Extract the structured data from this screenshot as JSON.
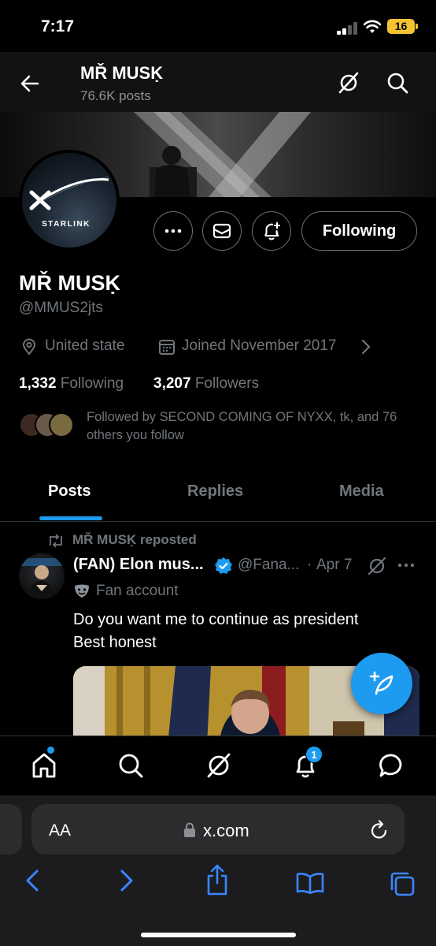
{
  "status_bar": {
    "time": "7:17",
    "battery": "16"
  },
  "header": {
    "title": "MŘ MUSḲ",
    "posts_count": "76.6K posts"
  },
  "banner": {
    "logo_text": "STARLINK"
  },
  "actions": {
    "following_label": "Following"
  },
  "profile": {
    "name": "MŘ MUSḲ",
    "handle": "@MMUS2jts",
    "location": "United state",
    "joined": "Joined November 2017",
    "following_count": "1,332",
    "following_label": "Following",
    "followers_count": "3,207",
    "followers_label": "Followers",
    "followed_by": "Followed by SECOND COMING OF NYXX, tk, and 76 others you follow"
  },
  "tabs": [
    {
      "label": "Posts",
      "active": true
    },
    {
      "label": "Replies",
      "active": false
    },
    {
      "label": "Media",
      "active": false
    }
  ],
  "post": {
    "repost_label": "MŘ MUSḲ reposted",
    "author": "(FAN) Elon mus...",
    "handle": "@Fana...",
    "dot": "·",
    "date": "Apr 7",
    "fan_label": "Fan account",
    "text_line1": "Do you want me to continue as president",
    "text_line2": "Best honest"
  },
  "bottom_nav": {
    "notification_count": "1"
  },
  "safari": {
    "aa_label": "AA",
    "url": "x.com"
  },
  "colors": {
    "accent": "#1d9bf0",
    "background": "#000000",
    "muted": "#71767b",
    "battery": "#f4c430"
  }
}
